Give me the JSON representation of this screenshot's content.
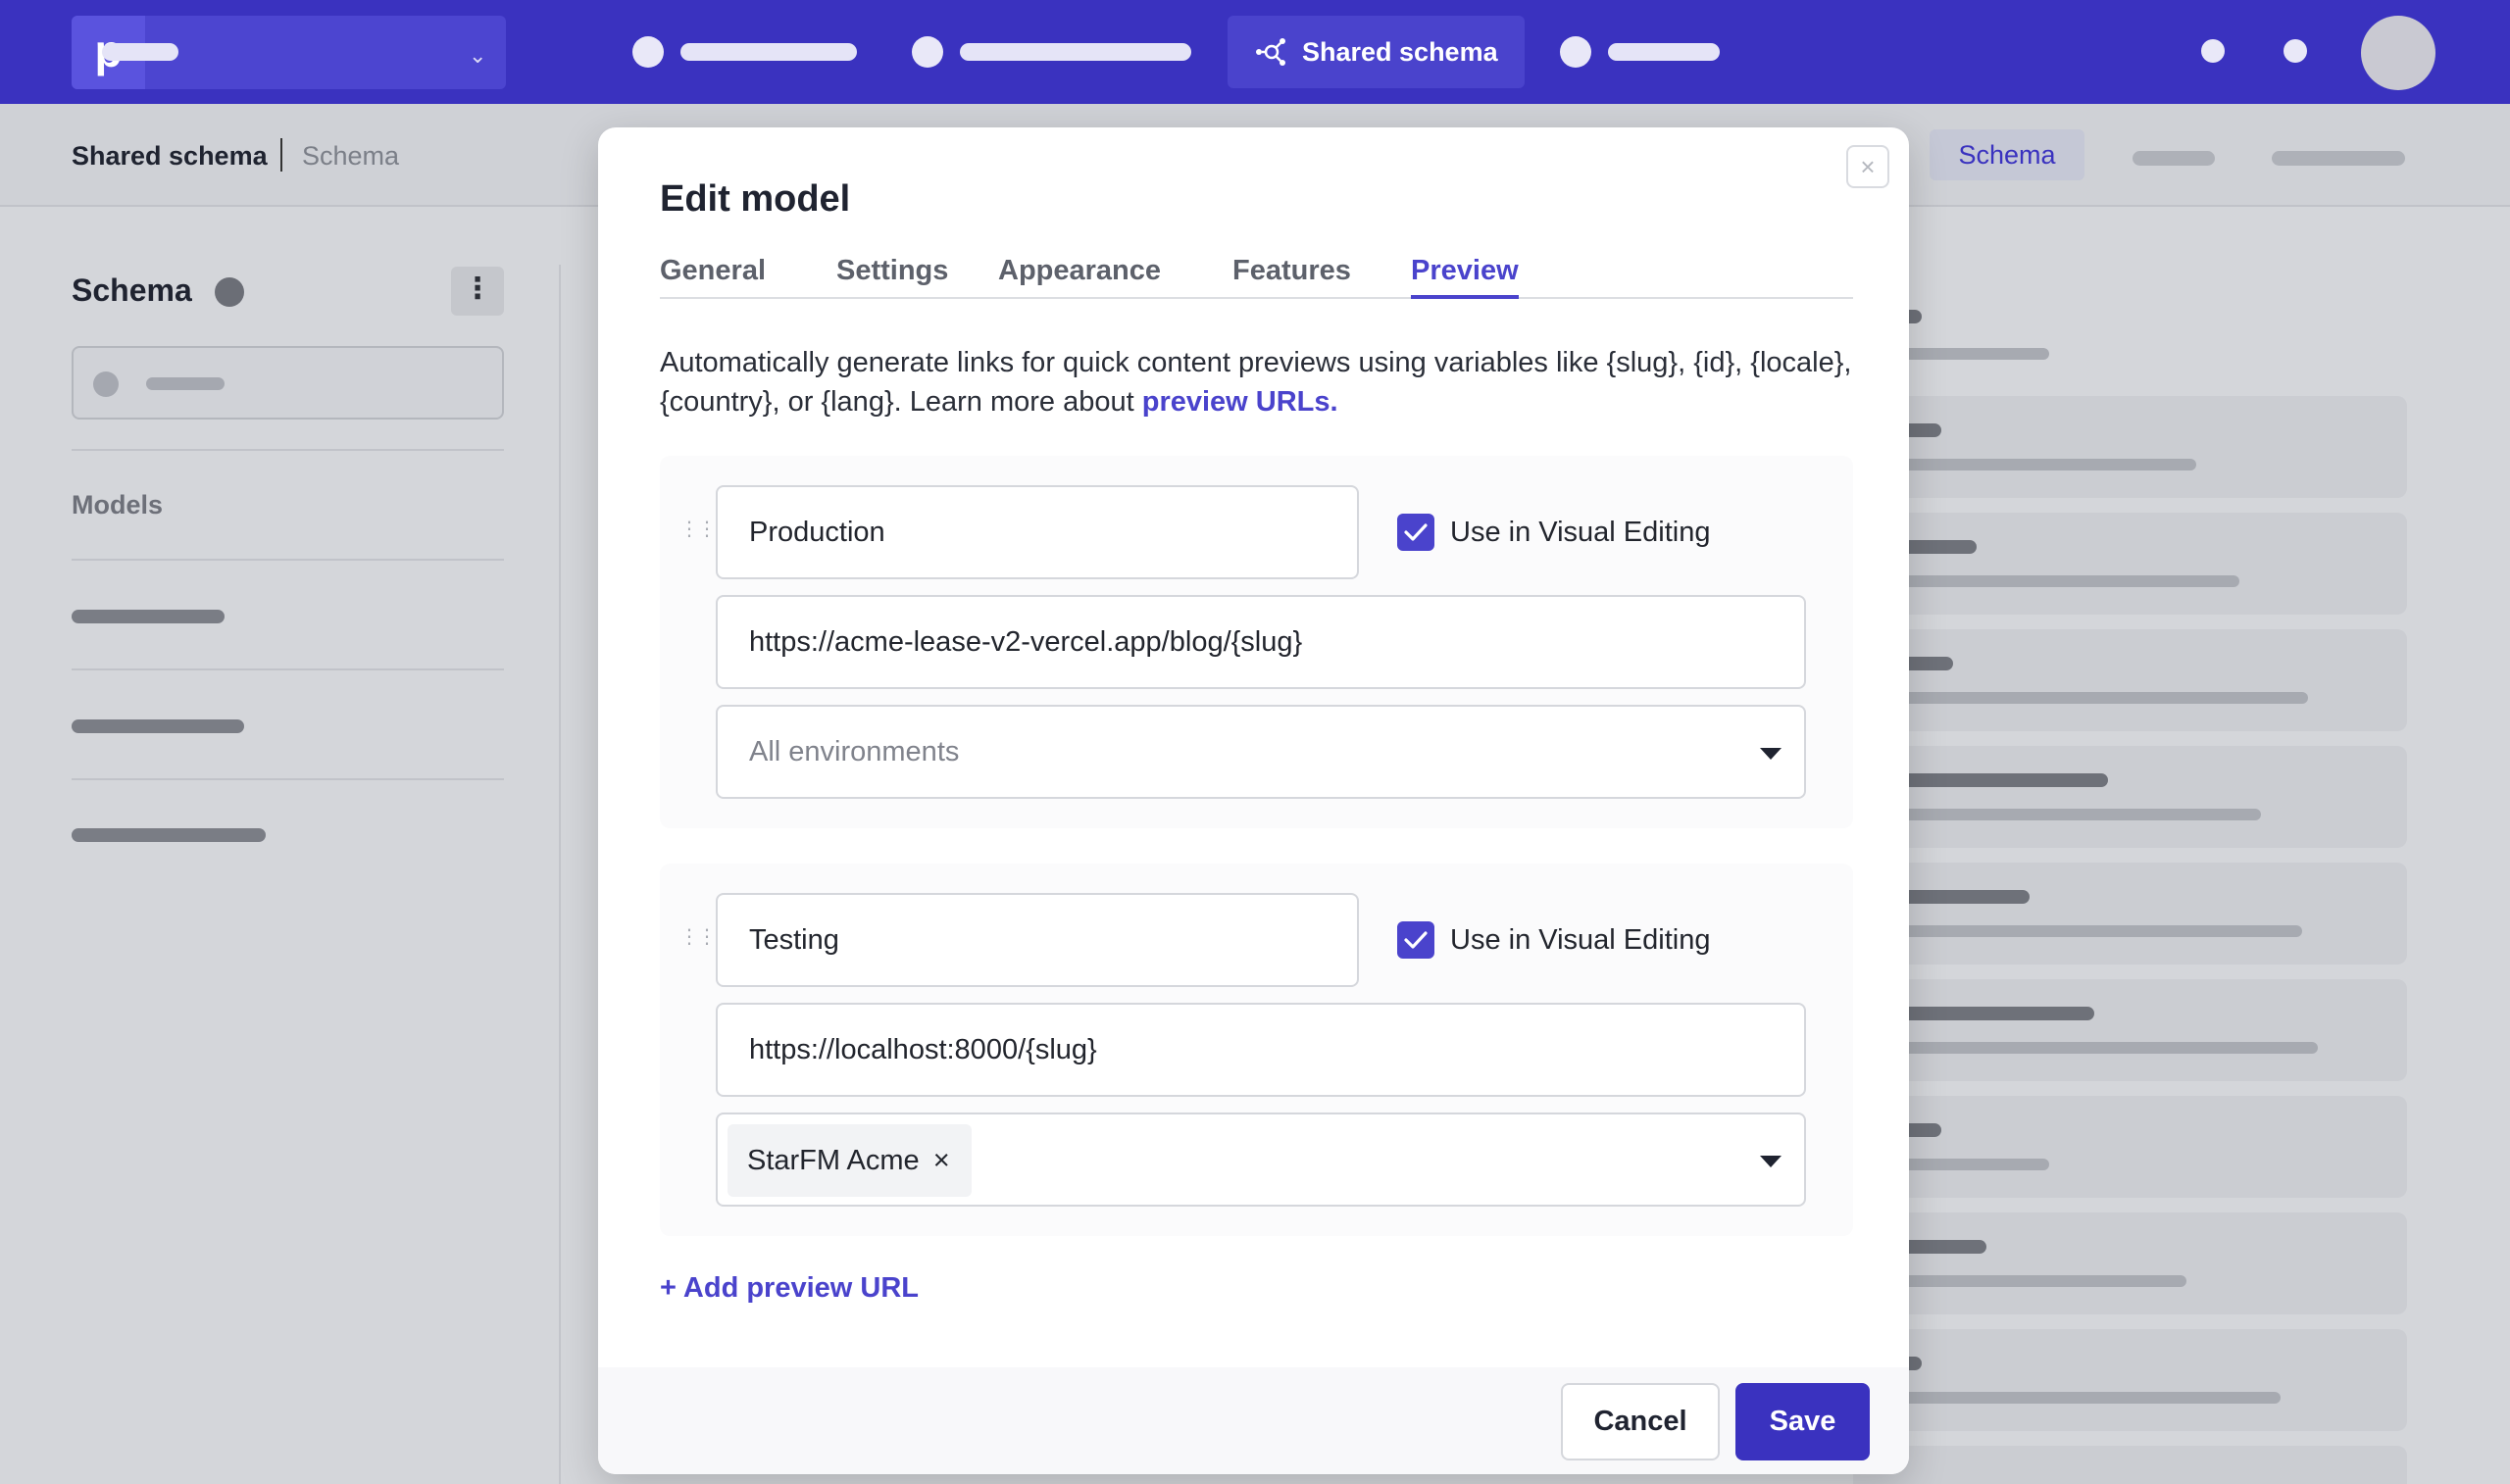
{
  "nav": {
    "active_label": "Shared schema"
  },
  "breadcrumb": {
    "project": "Shared schema",
    "section": "Schema"
  },
  "subnav": {
    "active_tab": "Schema"
  },
  "sidebar": {
    "title": "Schema",
    "models_heading": "Models"
  },
  "modal": {
    "title": "Edit model",
    "close_label": "×",
    "tabs": [
      {
        "label": "General",
        "active": false
      },
      {
        "label": "Settings",
        "active": false
      },
      {
        "label": "Appearance",
        "active": false
      },
      {
        "label": "Features",
        "active": false
      },
      {
        "label": "Preview",
        "active": true
      }
    ],
    "description": "Automatically generate links for quick content previews using variables like {slug}, {id}, {locale}, {country}, or {lang}. Learn more about ",
    "description_link": "preview URLs.",
    "preview_urls": [
      {
        "name": "Production",
        "use_in_visual_editing": true,
        "visual_editing_label": "Use in Visual Editing",
        "url": "https://acme-lease-v2-vercel.app/blog/{slug}",
        "environment_placeholder": "All environments",
        "environments": []
      },
      {
        "name": "Testing",
        "use_in_visual_editing": true,
        "visual_editing_label": "Use in Visual Editing",
        "url": "https://localhost:8000/{slug}",
        "environment_placeholder": "",
        "environments": [
          "StarFM Acme"
        ]
      }
    ],
    "add_label": "+ Add preview URL",
    "cancel_label": "Cancel",
    "save_label": "Save"
  },
  "colors": {
    "accent": "#4a43cc",
    "nav_bg": "#3a32bf"
  }
}
